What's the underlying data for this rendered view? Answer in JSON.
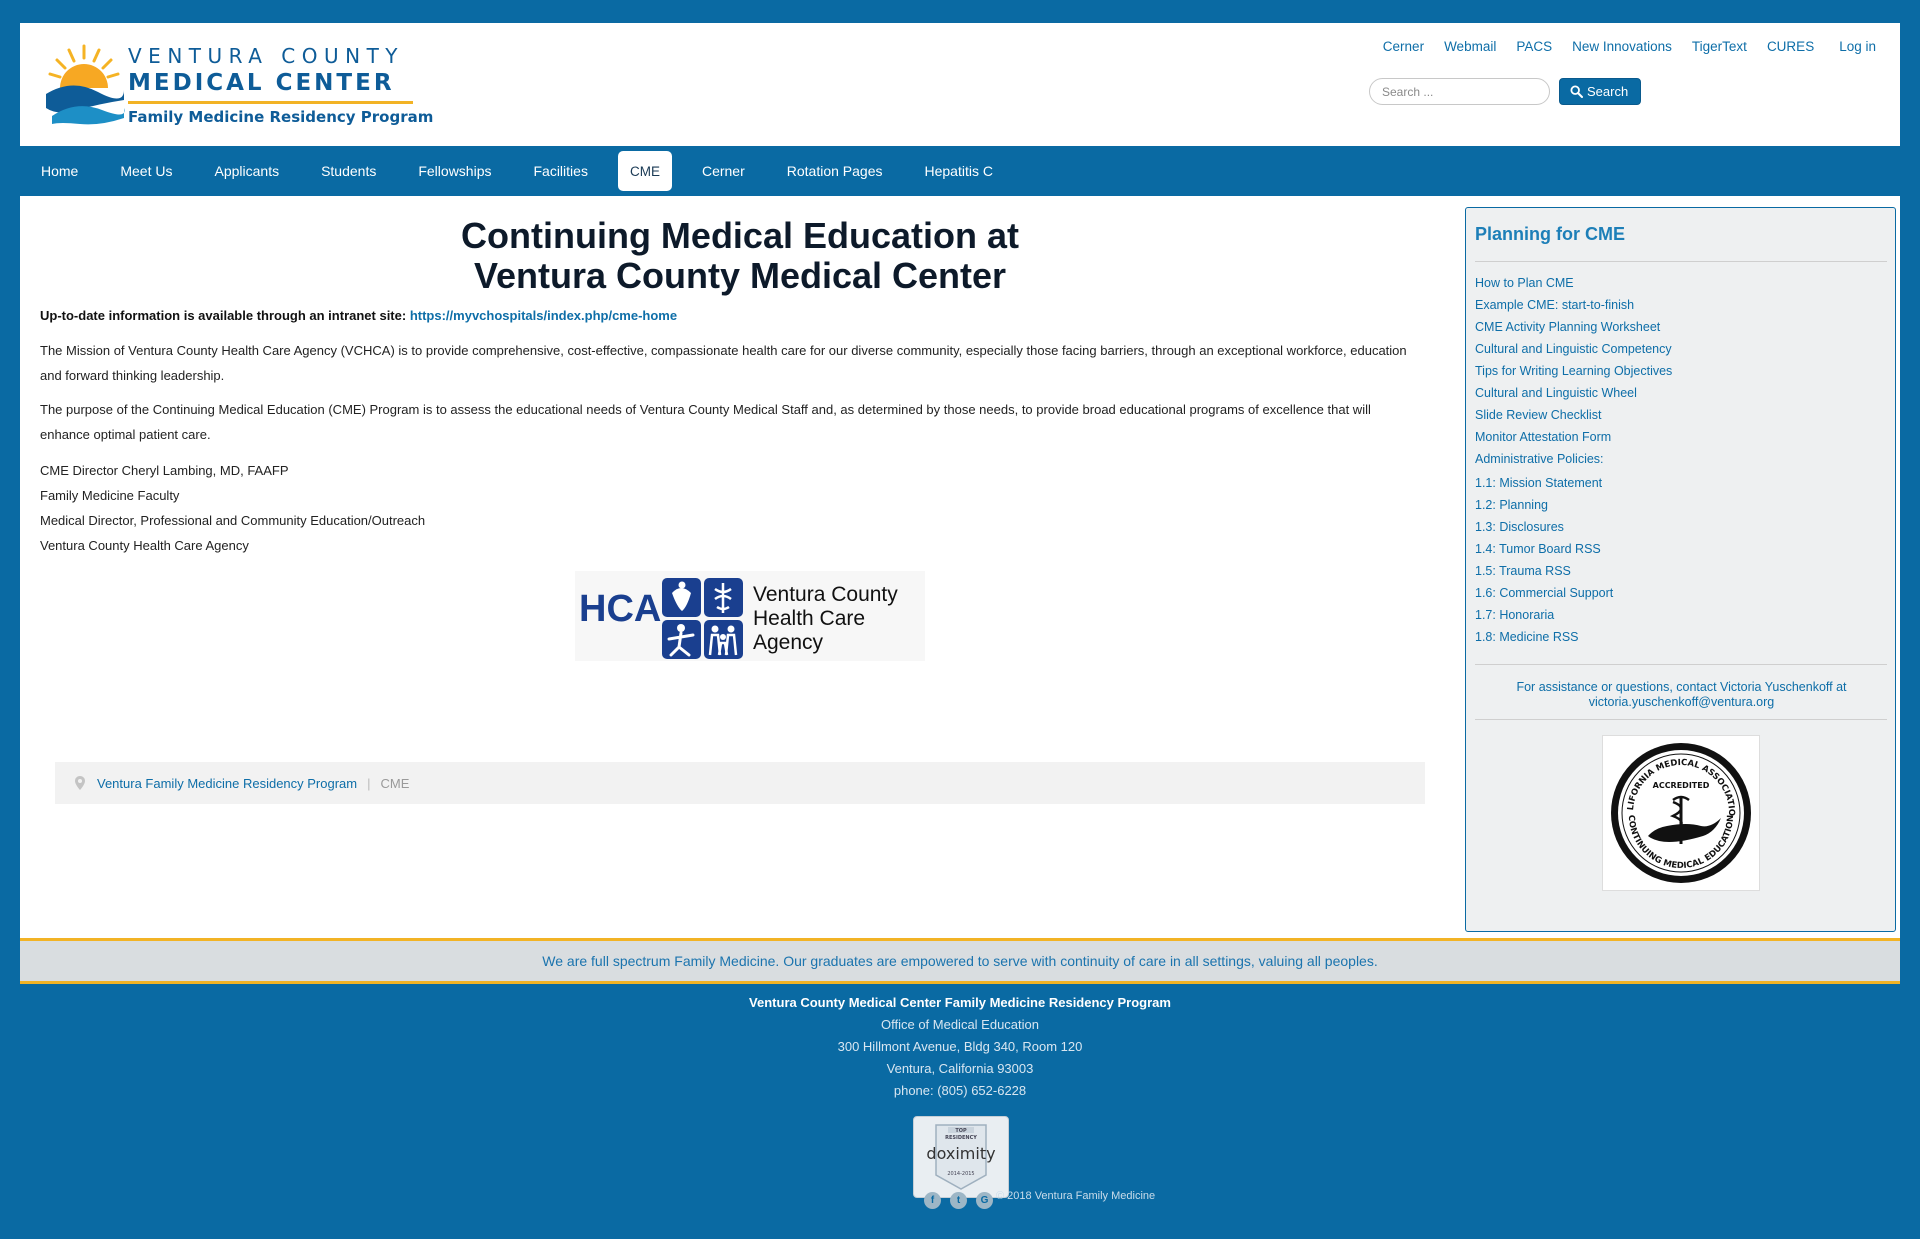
{
  "header": {
    "logo": {
      "line1": "VENTURA COUNTY",
      "line2": "MEDICAL CENTER",
      "line3": "Family Medicine Residency Program"
    },
    "top_links": [
      "Cerner",
      "Webmail",
      "PACS",
      "New Innovations",
      "TigerText",
      "CURES"
    ],
    "login_label": "Log in",
    "search": {
      "placeholder": "Search ...",
      "button_label": "Search"
    }
  },
  "nav": {
    "items": [
      "Home",
      "Meet Us",
      "Applicants",
      "Students",
      "Fellowships",
      "Facilities",
      "CME",
      "Cerner",
      "Rotation Pages",
      "Hepatitis C"
    ],
    "active": "CME"
  },
  "content": {
    "title_line1": "Continuing Medical Education at",
    "title_line2": "Ventura County Medical Center",
    "info_lead": "Up-to-date information is available through an intranet site:",
    "info_link": "https://myvchospitals/index.php/cme-home",
    "mission_para": "The Mission of Ventura County Health Care Agency (VCHCA) is to provide comprehensive, cost-effective, compassionate health care for our diverse community, especially those facing barriers, through an exceptional workforce, education and forward thinking leadership.",
    "purpose_para": "The purpose of the Continuing Medical Education (CME) Program is to assess the educational needs of Ventura County Medical Staff and, as determined by those needs, to provide broad educational programs of excellence that will enhance optimal patient care.",
    "staff": [
      "CME Director Cheryl Lambing, MD, FAAFP",
      "Family Medicine Faculty",
      "Medical Director, Professional and Community Education/Outreach",
      "Ventura County Health Care Agency"
    ],
    "hca_logo": {
      "abbr": "HCA",
      "line1": "Ventura County",
      "line2": "Health Care",
      "line3": "Agency"
    },
    "breadcrumb": {
      "home": "Ventura Family Medicine Residency Program",
      "current": "CME"
    }
  },
  "sidebar": {
    "title": "Planning for CME",
    "links": [
      "How to Plan CME",
      "Example CME: start-to-finish",
      "CME Activity Planning Worksheet",
      "Cultural and Linguistic Competency",
      "Tips for Writing Learning Objectives",
      "Cultural and Linguistic Wheel",
      "Slide Review Checklist",
      "Monitor Attestation Form"
    ],
    "policies_label": "Administrative Policies:",
    "policies": [
      "1.1: Mission Statement",
      "1.2: Planning",
      "1.3: Disclosures",
      "1.4: Tumor Board RSS",
      "1.5: Trauma RSS",
      "1.6: Commercial Support",
      "1.7: Honoraria",
      "1.8: Medicine RSS"
    ],
    "contact_line1": "For assistance or questions, contact Victoria Yuschenkoff at",
    "contact_line2": "victoria.yuschenkoff@ventura.org",
    "seal": {
      "top_text": "CALIFORNIA MEDICAL ASSOCIATION",
      "accredited": "ACCREDITED",
      "bottom_text": "CONTINUING MEDICAL EDUCATION"
    }
  },
  "mission_banner": "We are full spectrum Family Medicine. Our graduates are empowered to serve with continuity of care in all settings, valuing all peoples.",
  "footer": {
    "org": "Ventura County Medical Center Family Medicine Residency Program",
    "lines": [
      "Office of Medical Education",
      "300 Hillmont Avenue, Bldg 340, Room 120",
      "Ventura, California 93003",
      "phone: (805) 652-6228"
    ],
    "badge": {
      "top": "TOP",
      "residency": "RESIDENCY",
      "brand": "doximity",
      "years": "2014-2015"
    },
    "social": [
      "f",
      "t",
      "G"
    ],
    "copyright": "© 2018 Ventura Family Medicine"
  }
}
